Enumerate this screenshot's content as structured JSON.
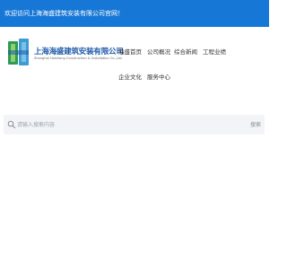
{
  "colors": {
    "brand": "#1677d6",
    "logo_green": "#2e9a57",
    "logo_blue": "#1e5aa8"
  },
  "topbar": {
    "welcome": "欢迎访问上海海盛建筑安装有限公司官网！"
  },
  "logo": {
    "name": "上海海盛建筑安装有限公司",
    "subtitle": "Shanghai Haisheng Construction & Installation Co.,Ltd."
  },
  "nav": {
    "items": [
      {
        "label": "海盛首页"
      },
      {
        "label": "公司概况"
      },
      {
        "label": "综合新闻"
      },
      {
        "label": "工程业绩"
      },
      {
        "label": "企业文化"
      },
      {
        "label": "服务中心"
      }
    ]
  },
  "search": {
    "icon": "search-icon",
    "placeholder": "请输入搜索内容",
    "value": "",
    "button_label": "搜索"
  }
}
